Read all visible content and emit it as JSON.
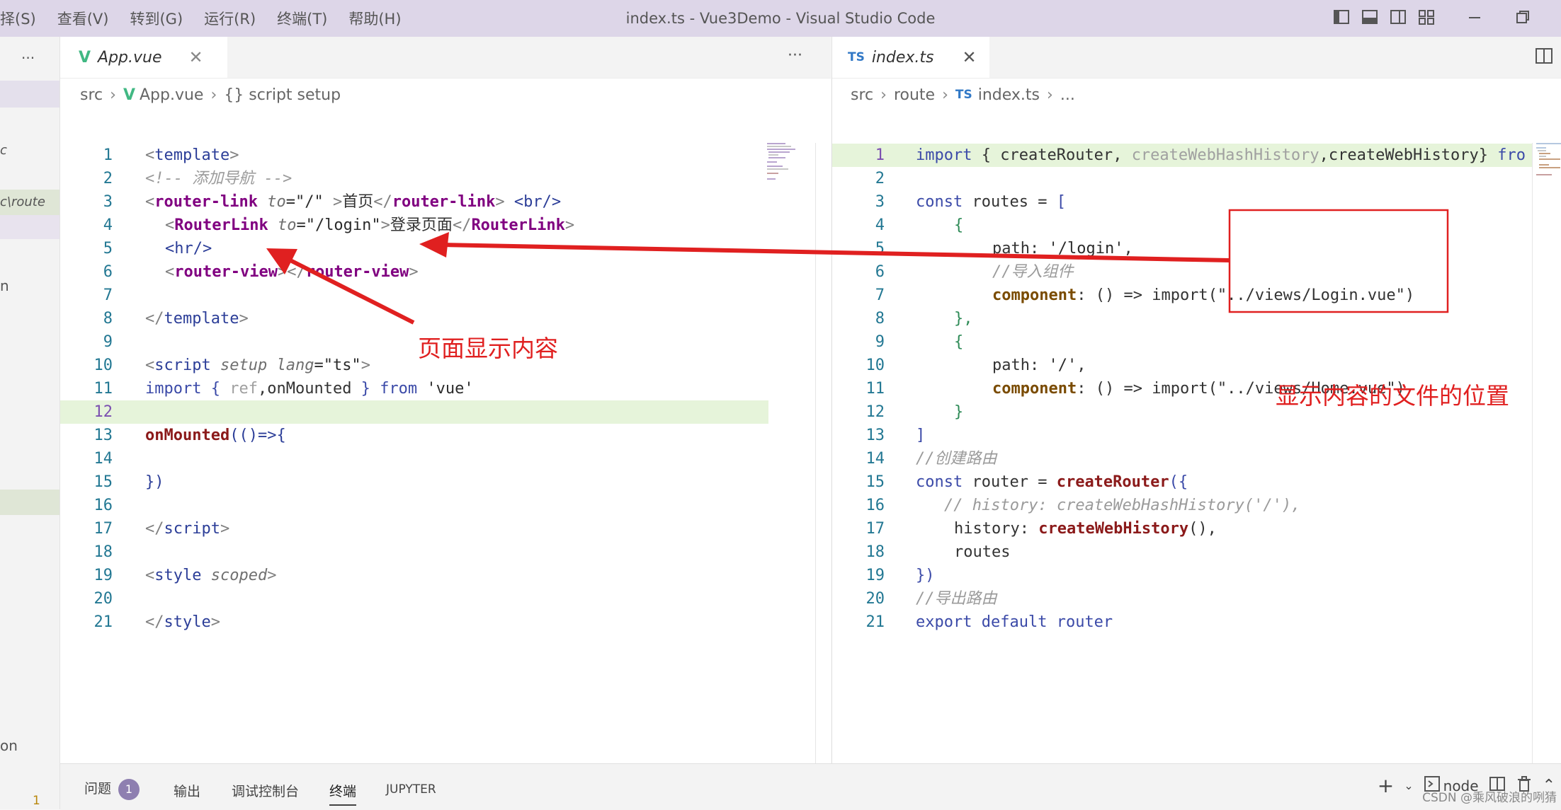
{
  "titlebar": {
    "menu": [
      "择(S)",
      "查看(V)",
      "转到(G)",
      "运行(R)",
      "终端(T)",
      "帮助(H)"
    ],
    "title": "index.ts - Vue3Demo - Visual Studio Code"
  },
  "sidebar": {
    "more": "···",
    "rows": [
      "c",
      "c\\route",
      "n",
      "on",
      "1"
    ]
  },
  "left_editor": {
    "tab_label": "App.vue",
    "tab_icon": "V",
    "more": "···",
    "breadcrumb": [
      "src",
      "App.vue",
      "{} script setup"
    ],
    "lines": [
      "1",
      "2",
      "3",
      "4",
      "5",
      "6",
      "7",
      "8",
      "9",
      "10",
      "11",
      "12",
      "13",
      "14",
      "15",
      "16",
      "17",
      "18",
      "19",
      "20",
      "21"
    ],
    "code": {
      "l1": [
        "<",
        "template",
        ">"
      ],
      "l2": "<!-- 添加导航 -->",
      "l3": [
        "<",
        "router-link",
        " to",
        "=\"/\" ",
        ">",
        "首页",
        "</",
        "router-link",
        "> ",
        "<br/>"
      ],
      "l4": [
        "<",
        "RouterLink",
        " to",
        "=\"/login\"",
        ">",
        "登录页面",
        "</",
        "RouterLink",
        ">"
      ],
      "l5": "<hr/>",
      "l6": [
        "<",
        "router-view",
        "></",
        "router-view",
        ">"
      ],
      "l8": [
        "</",
        "template",
        ">"
      ],
      "l10": [
        "<",
        "script",
        " setup",
        " lang",
        "=\"ts\"",
        ">"
      ],
      "l11": [
        "import",
        " { ",
        "ref",
        ",onMounted",
        " } ",
        "from",
        " 'vue'"
      ],
      "l13": [
        "onMounted",
        "(()=>{"
      ],
      "l15": "})",
      "l17": [
        "</",
        "script",
        ">"
      ],
      "l19": [
        "<",
        "style",
        " scoped",
        ">"
      ],
      "l21": [
        "</",
        "style",
        ">"
      ]
    }
  },
  "right_editor": {
    "tab_label": "index.ts",
    "tab_icon": "TS",
    "close": "✕",
    "breadcrumb": [
      "src",
      "route",
      "TS",
      "index.ts",
      "..."
    ],
    "lines": [
      "1",
      "2",
      "3",
      "4",
      "5",
      "6",
      "7",
      "8",
      "9",
      "10",
      "11",
      "12",
      "13",
      "14",
      "15",
      "16",
      "17",
      "18",
      "19",
      "20",
      "21"
    ],
    "code": {
      "l1": [
        "import",
        " { ",
        "createRouter",
        ", ",
        "createWebHashHistory",
        ",",
        "createWebHistory",
        "} ",
        "fro"
      ],
      "l3": [
        "const",
        " routes ",
        "=",
        " ["
      ],
      "l4": "{",
      "l5": [
        "path",
        ": ",
        "'/login'",
        ","
      ],
      "l6": "//导入组件",
      "l7": [
        "component",
        ": ",
        "() => ",
        "import",
        "(\"../views/Login.vue\")"
      ],
      "l8": "},",
      "l9": "{",
      "l10": [
        "path",
        ": ",
        "'/'",
        ","
      ],
      "l11": [
        "component",
        ": ",
        "() => ",
        "import",
        "(\"../views/Home.vue\")"
      ],
      "l12": "}",
      "l13": "]",
      "l14": "//创建路由",
      "l15": [
        "const",
        " router ",
        "= ",
        "createRouter",
        "({"
      ],
      "l16": "// history: createWebHashHistory('/'),",
      "l17": [
        "history",
        ": ",
        "createWebHistory",
        "(),"
      ],
      "l18": "routes",
      "l19": "})",
      "l20": "//导出路由",
      "l21": [
        "export",
        " default ",
        "router"
      ]
    }
  },
  "panel": {
    "tabs": [
      "问题",
      "输出",
      "调试控制台",
      "终端",
      "JUPYTER"
    ],
    "problems_count": "1",
    "active_tab": "终端",
    "terminal_name": "node"
  },
  "annotations": {
    "left_label": "页面显示内容",
    "right_label": "显示内容的文件的位置",
    "color": "#e02020"
  },
  "watermark": "CSDN @乘风破浪的咧猜",
  "colors": {
    "titlebar_bg": "#ddd6e8",
    "highlight_line": "#e6f4da",
    "badge": "#8e7fb0",
    "vue_icon": "#41b883",
    "ts_icon": "#3178c6"
  }
}
